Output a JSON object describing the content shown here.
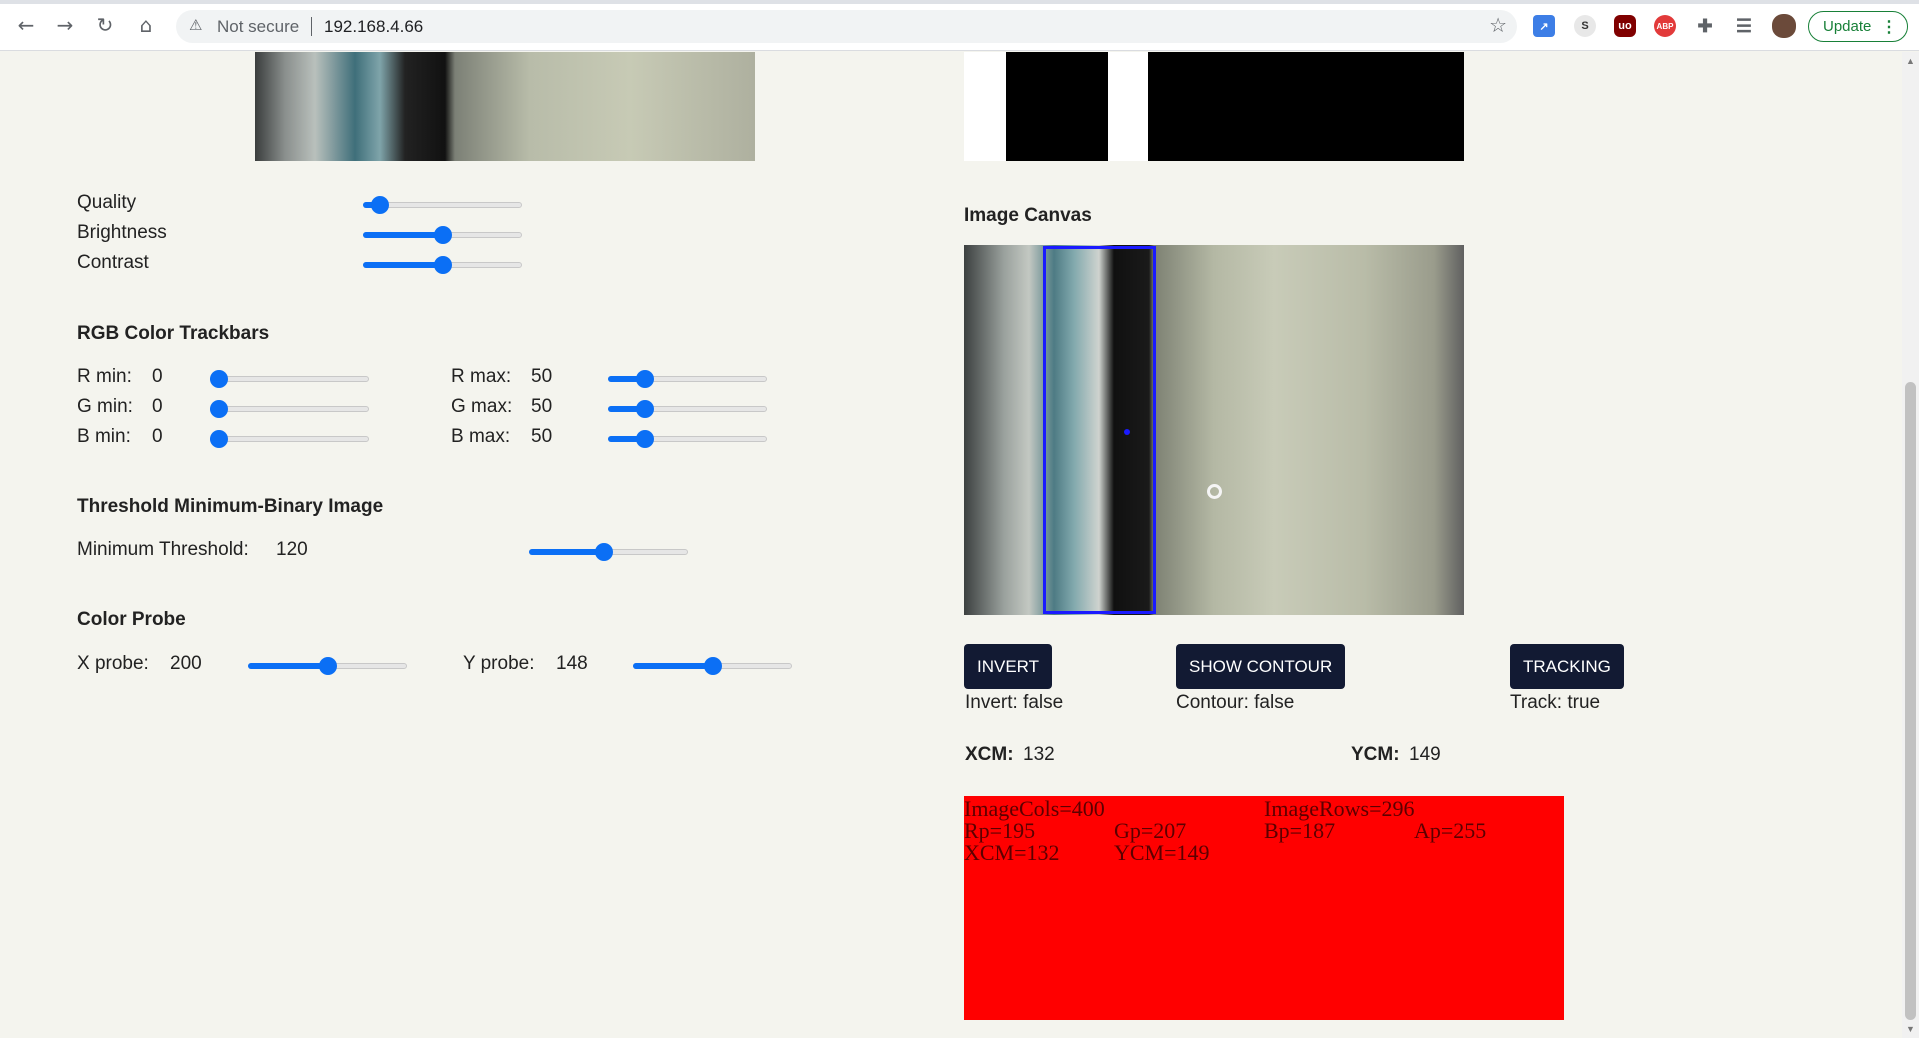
{
  "browser": {
    "security_label": "Not secure",
    "url": "192.168.4.66",
    "update_label": "Update"
  },
  "quality_controls": [
    {
      "label": "Quality",
      "value": 0.06
    },
    {
      "label": "Brightness",
      "value": 0.5
    },
    {
      "label": "Contrast",
      "value": 0.5
    }
  ],
  "rgb": {
    "heading": "RGB Color Trackbars",
    "r_min": {
      "label": "R min:",
      "value": "0",
      "level": 0.0
    },
    "g_min": {
      "label": "G min:",
      "value": "0",
      "level": 0.0
    },
    "b_min": {
      "label": "B min:",
      "value": "0",
      "level": 0.0
    },
    "r_max": {
      "label": "R max:",
      "value": "50",
      "level": 0.2
    },
    "g_max": {
      "label": "G max:",
      "value": "50",
      "level": 0.2
    },
    "b_max": {
      "label": "B max:",
      "value": "50",
      "level": 0.2
    }
  },
  "threshold": {
    "heading": "Threshold Minimum-Binary Image",
    "label": "Minimum Threshold:",
    "value": "120",
    "level": 0.47
  },
  "probe": {
    "heading": "Color Probe",
    "x_label": "X probe:",
    "x_value": "200",
    "x_level": 0.5,
    "y_label": "Y probe:",
    "y_value": "148",
    "y_level": 0.5
  },
  "canvas": {
    "heading": "Image Canvas"
  },
  "buttons": {
    "invert": "INVERT",
    "contour": "SHOW CONTOUR",
    "tracking": "TRACKING"
  },
  "status": {
    "invert": "Invert: false",
    "contour": "Contour: false",
    "track": "Track: true"
  },
  "centroid": {
    "xcm_label": "XCM:",
    "xcm_value": "132",
    "ycm_label": "YCM:",
    "ycm_value": "149"
  },
  "info_canvas": {
    "image_cols": "ImageCols=400",
    "image_rows": "ImageRows=296",
    "rp": "Rp=195",
    "gp": "Gp=207",
    "bp": "Bp=187",
    "ap": "Ap=255",
    "xcm": "XCM=132",
    "ycm": "YCM=149",
    "bg_color": "#ff0000"
  },
  "colors": {
    "accent": "#0b6ff5",
    "button_bg": "#121a33",
    "tracking_box": "#1a1aff"
  }
}
